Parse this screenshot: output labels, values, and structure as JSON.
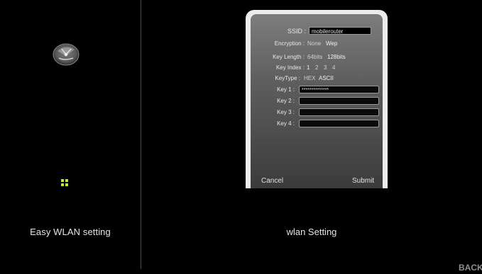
{
  "sidebar": {
    "label": "Easy WLAN setting"
  },
  "main": {
    "label": "wlan Setting"
  },
  "dialog": {
    "ssid_label": "SSID :",
    "ssid_value": "mobilerouter",
    "encryption_label": "Encryption :",
    "encryption_options": [
      "None",
      "Wep"
    ],
    "key_length_label": "Key Length :",
    "key_length_options": [
      "64bits",
      "128bits"
    ],
    "key_index_label": "Key Index :",
    "key_index_options": [
      "1",
      "2",
      "3",
      "4"
    ],
    "key_type_label": "KeyType :",
    "key_type_options": [
      "HEX",
      "ASCII"
    ],
    "key1_label": "Key 1 :",
    "key1_value": "**************",
    "key2_label": "Key 2 :",
    "key2_value": "",
    "key3_label": "Key 3 :",
    "key3_value": "",
    "key4_label": "Key 4 :",
    "key4_value": "",
    "cancel_label": "Cancel",
    "submit_label": "Submit"
  },
  "footer": {
    "back_label": "BACK"
  },
  "icons": {
    "logo": "router-globe-icon",
    "status": "green-dots-icon"
  },
  "colors": {
    "background": "#000000",
    "status_green": "#b6ee31",
    "dialog_frame": "#ececec"
  }
}
